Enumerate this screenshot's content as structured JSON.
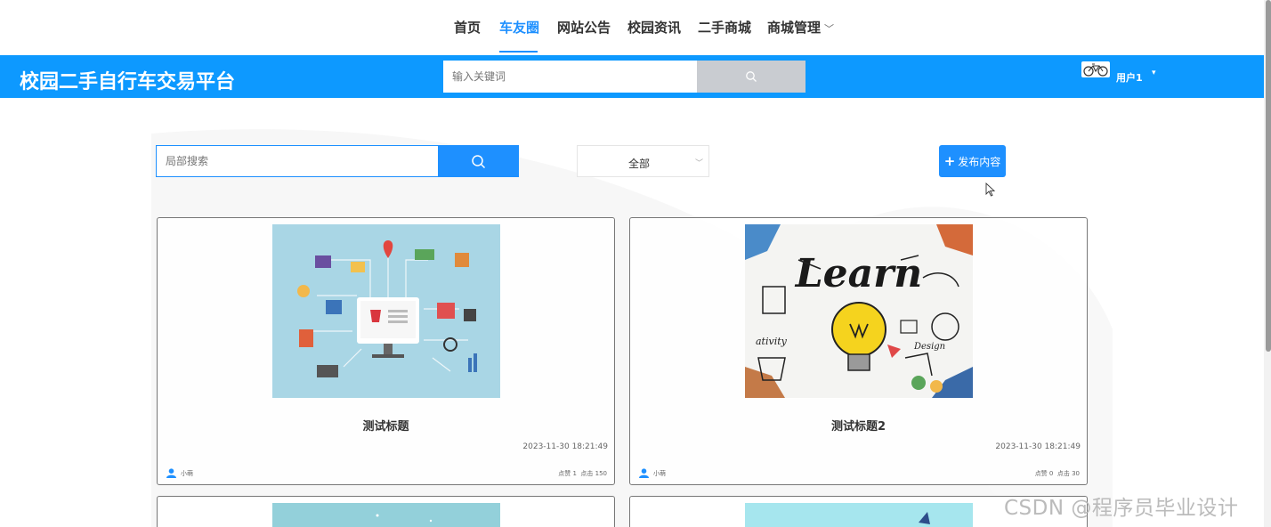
{
  "nav": {
    "items": [
      "首页",
      "车友圈",
      "网站公告",
      "校园资讯",
      "二手商城",
      "商城管理"
    ],
    "active": "车友圈",
    "dropdown_caret": "﹀"
  },
  "header": {
    "brand": "校园二手自行车交易平台",
    "search_placeholder": "输入关键词",
    "user_name": "用户1",
    "user_caret": "▾",
    "bar_color": "#0d99ff"
  },
  "filters": {
    "local_search_placeholder": "局部搜索",
    "select_value": "全部",
    "select_arrow": "﹀",
    "publish_plus": "+",
    "publish_label": "发布内容",
    "accent": "#1e90ff"
  },
  "posts": [
    {
      "title": "测试标题",
      "time": "2023-11-30 18:21:49",
      "author": "小萌",
      "likes_label": "点赞",
      "likes": "1",
      "clicks_label": "点击",
      "clicks": "150",
      "image_icon": "ecommerce-illustration"
    },
    {
      "title": "测试标题2",
      "time": "2023-11-30 18:21:49",
      "author": "小萌",
      "likes_label": "点赞",
      "likes": "0",
      "clicks_label": "点击",
      "clicks": "30",
      "image_icon": "learn-lightbulb-illustration",
      "image_text": "Learn"
    }
  ],
  "watermark": "CSDN @程序员毕业设计"
}
